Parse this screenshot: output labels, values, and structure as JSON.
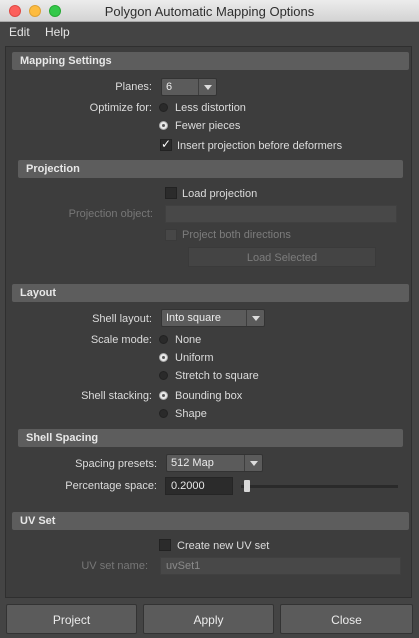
{
  "window": {
    "title": "Polygon Automatic Mapping Options"
  },
  "menu": {
    "items": [
      "Edit",
      "Help"
    ]
  },
  "mapping_settings": {
    "header": "Mapping Settings",
    "planes_label": "Planes:",
    "planes_value": "6",
    "optimize_label": "Optimize for:",
    "optimize_options": [
      "Less distortion",
      "Fewer pieces"
    ],
    "optimize_selected": "Fewer pieces",
    "insert_projection_label": "Insert projection before deformers",
    "insert_projection_checked": true
  },
  "projection": {
    "header": "Projection",
    "load_projection_label": "Load projection",
    "projection_object_label": "Projection object:",
    "projection_object_value": "",
    "project_both_label": "Project both directions",
    "load_selected_label": "Load Selected"
  },
  "layout": {
    "header": "Layout",
    "shell_layout_label": "Shell layout:",
    "shell_layout_value": "Into square",
    "scale_mode_label": "Scale mode:",
    "scale_mode_options": [
      "None",
      "Uniform",
      "Stretch to square"
    ],
    "scale_mode_selected": "Uniform",
    "shell_stacking_label": "Shell stacking:",
    "shell_stacking_options": [
      "Bounding box",
      "Shape"
    ],
    "shell_stacking_selected": "Bounding box"
  },
  "shell_spacing": {
    "header": "Shell Spacing",
    "spacing_presets_label": "Spacing presets:",
    "spacing_presets_value": "512 Map",
    "percentage_space_label": "Percentage space:",
    "percentage_space_value": "0.2000",
    "slider_fraction": 0.02
  },
  "uv_set": {
    "header": "UV Set",
    "create_new_label": "Create new UV set",
    "uv_set_name_label": "UV set name:",
    "uv_set_name_value": "uvSet1"
  },
  "buttons": {
    "project": "Project",
    "apply": "Apply",
    "close": "Close"
  }
}
